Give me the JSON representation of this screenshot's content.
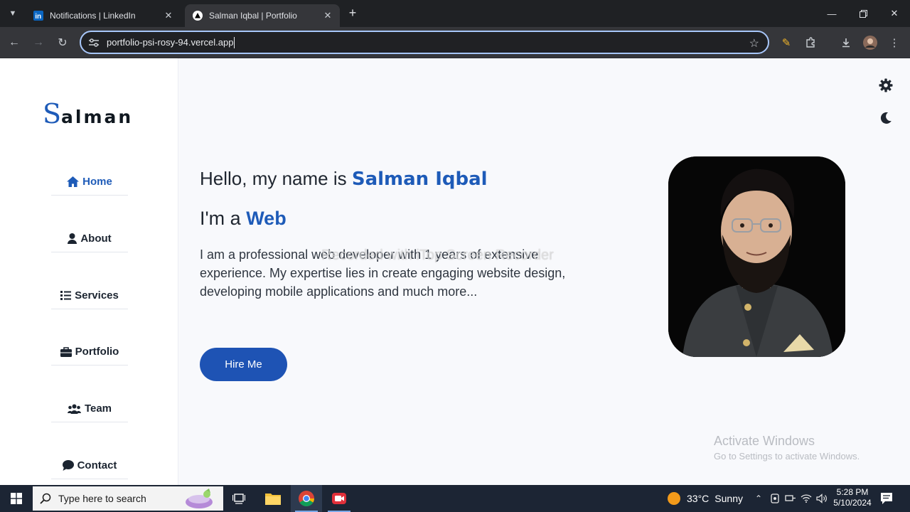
{
  "browser": {
    "tabs": [
      {
        "title": "Notifications | LinkedIn",
        "active": false
      },
      {
        "title": "Salman Iqbal | Portfolio",
        "active": true
      }
    ],
    "url": "portfolio-psi-rosy-94.vercel.app"
  },
  "site": {
    "logo_first": "S",
    "logo_rest": "alman",
    "nav": [
      {
        "label": "Home",
        "icon": "home-icon",
        "active": true
      },
      {
        "label": "About",
        "icon": "user-icon",
        "active": false
      },
      {
        "label": "Services",
        "icon": "list-icon",
        "active": false
      },
      {
        "label": "Portfolio",
        "icon": "briefcase-icon",
        "active": false
      },
      {
        "label": "Team",
        "icon": "users-icon",
        "active": false
      },
      {
        "label": "Contact",
        "icon": "comment-icon",
        "active": false
      }
    ],
    "hero": {
      "greeting": "Hello, my name is",
      "name": "Salman Iqbal",
      "role_prefix": "I'm a",
      "role": "Web",
      "description": "I am a professional web developer with 1 years of extensive experience. My expertise lies in create engaging website design, developing mobile applications and much more...",
      "cta": "Hire Me"
    },
    "accent_color": "#1e5bb8"
  },
  "overlay": {
    "watermark": "Recorded with iTop Screen Recorder",
    "activate_title": "Activate Windows",
    "activate_subtitle": "Go to Settings to activate Windows."
  },
  "taskbar": {
    "search_placeholder": "Type here to search",
    "weather_temp": "33°C",
    "weather_text": "Sunny",
    "time": "5:28 PM",
    "date": "5/10/2024"
  }
}
